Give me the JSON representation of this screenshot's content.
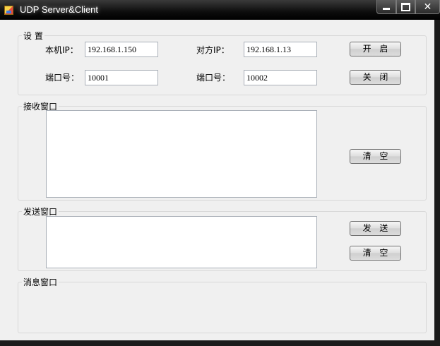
{
  "window": {
    "title": "UDP Server&Client",
    "close_glyph": "✕"
  },
  "settings": {
    "title": "设 置",
    "local_ip_label": "本机IP：",
    "local_ip": "192.168.1.150",
    "remote_ip_label": "对方IP：",
    "remote_ip": "192.168.1.13",
    "local_port_label": "端口号：",
    "local_port": "10001",
    "remote_port_label": "端口号：",
    "remote_port": "10002",
    "open_label": "开 启",
    "close_label": "关 闭"
  },
  "receive": {
    "title": "接收窗口",
    "content": "",
    "clear_label": "清 空"
  },
  "send": {
    "title": "发送窗口",
    "content": "",
    "send_label": "发 送",
    "clear_label": "清 空"
  },
  "message": {
    "title": "消息窗口"
  }
}
